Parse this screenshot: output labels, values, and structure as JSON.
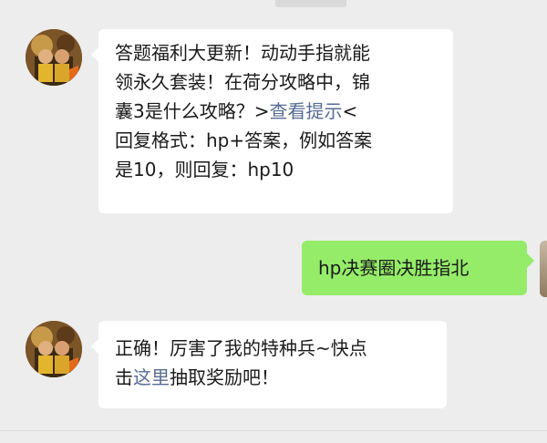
{
  "messages": [
    {
      "sender": "other",
      "avatar_icon": "game-avatar-icon",
      "lines": [
        {
          "parts": [
            {
              "text": "答题福利大更新！动动手指就能"
            }
          ]
        },
        {
          "parts": [
            {
              "text": "领永久套装！在荷分攻略中，锦"
            }
          ]
        },
        {
          "parts": [
            {
              "text": "囊3是什么攻略？>"
            },
            {
              "text": "查看提示",
              "link": true
            },
            {
              "text": "<"
            }
          ]
        },
        {
          "parts": [
            {
              "text": "回复格式：hp+答案，例如答案"
            }
          ]
        },
        {
          "parts": [
            {
              "text": "是10，则回复：hp10"
            }
          ]
        }
      ]
    },
    {
      "sender": "self",
      "text": "hp决赛圈决胜指北"
    },
    {
      "sender": "other",
      "avatar_icon": "game-avatar-icon",
      "lines": [
        {
          "parts": [
            {
              "text": "正确！厉害了我的特种兵~快点"
            }
          ]
        },
        {
          "parts": [
            {
              "text": "击"
            },
            {
              "text": "这里",
              "link": true
            },
            {
              "text": "抽取奖励吧！"
            }
          ]
        }
      ]
    }
  ],
  "colors": {
    "background": "#ededed",
    "bubble_other": "#ffffff",
    "bubble_self": "#95ec69",
    "link": "#576b95"
  }
}
